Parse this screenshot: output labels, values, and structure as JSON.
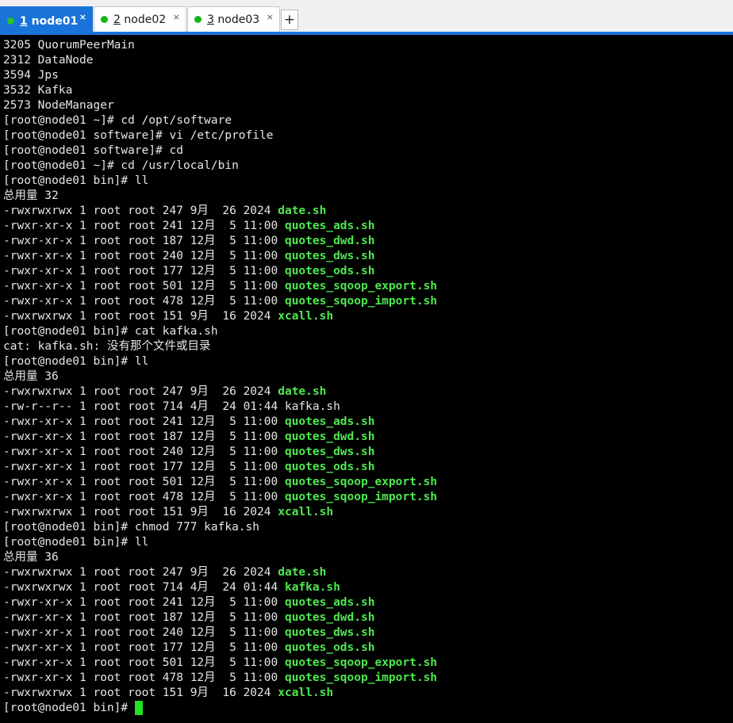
{
  "tabs": [
    {
      "num": "1",
      "name": "node01",
      "active": true
    },
    {
      "num": "2",
      "name": "node02",
      "active": false
    },
    {
      "num": "3",
      "name": "node03",
      "active": false
    }
  ],
  "new_tab_label": "+",
  "close_glyph": "×",
  "colors": {
    "tab_active": "#1a73d9",
    "status_dot": "#16b316",
    "terminal_bg": "#000000",
    "terminal_text": "#e6e6e6",
    "executable": "#4ee84e",
    "cursor": "#22e022"
  },
  "terminal_lines": [
    {
      "text": "3205 QuorumPeerMain",
      "file": ""
    },
    {
      "text": "2312 DataNode",
      "file": ""
    },
    {
      "text": "3594 Jps",
      "file": ""
    },
    {
      "text": "3532 Kafka",
      "file": ""
    },
    {
      "text": "2573 NodeManager",
      "file": ""
    },
    {
      "text": "[root@node01 ~]# cd /opt/software",
      "file": ""
    },
    {
      "text": "[root@node01 software]# vi /etc/profile",
      "file": ""
    },
    {
      "text": "[root@node01 software]# cd",
      "file": ""
    },
    {
      "text": "[root@node01 ~]# cd /usr/local/bin",
      "file": ""
    },
    {
      "text": "[root@node01 bin]# ll",
      "file": ""
    },
    {
      "text": "总用量 32",
      "file": ""
    },
    {
      "text": "-rwxrwxrwx 1 root root 247 9月  26 2024 ",
      "file": "date.sh"
    },
    {
      "text": "-rwxr-xr-x 1 root root 241 12月  5 11:00 ",
      "file": "quotes_ads.sh"
    },
    {
      "text": "-rwxr-xr-x 1 root root 187 12月  5 11:00 ",
      "file": "quotes_dwd.sh"
    },
    {
      "text": "-rwxr-xr-x 1 root root 240 12月  5 11:00 ",
      "file": "quotes_dws.sh"
    },
    {
      "text": "-rwxr-xr-x 1 root root 177 12月  5 11:00 ",
      "file": "quotes_ods.sh"
    },
    {
      "text": "-rwxr-xr-x 1 root root 501 12月  5 11:00 ",
      "file": "quotes_sqoop_export.sh"
    },
    {
      "text": "-rwxr-xr-x 1 root root 478 12月  5 11:00 ",
      "file": "quotes_sqoop_import.sh"
    },
    {
      "text": "-rwxrwxrwx 1 root root 151 9月  16 2024 ",
      "file": "xcall.sh"
    },
    {
      "text": "[root@node01 bin]# cat kafka.sh",
      "file": ""
    },
    {
      "text": "cat: kafka.sh: 没有那个文件或目录",
      "file": ""
    },
    {
      "text": "[root@node01 bin]# ll",
      "file": ""
    },
    {
      "text": "总用量 36",
      "file": ""
    },
    {
      "text": "-rwxrwxrwx 1 root root 247 9月  26 2024 ",
      "file": "date.sh"
    },
    {
      "text": "-rw-r--r-- 1 root root 714 4月  24 01:44 kafka.sh",
      "file": ""
    },
    {
      "text": "-rwxr-xr-x 1 root root 241 12月  5 11:00 ",
      "file": "quotes_ads.sh"
    },
    {
      "text": "-rwxr-xr-x 1 root root 187 12月  5 11:00 ",
      "file": "quotes_dwd.sh"
    },
    {
      "text": "-rwxr-xr-x 1 root root 240 12月  5 11:00 ",
      "file": "quotes_dws.sh"
    },
    {
      "text": "-rwxr-xr-x 1 root root 177 12月  5 11:00 ",
      "file": "quotes_ods.sh"
    },
    {
      "text": "-rwxr-xr-x 1 root root 501 12月  5 11:00 ",
      "file": "quotes_sqoop_export.sh"
    },
    {
      "text": "-rwxr-xr-x 1 root root 478 12月  5 11:00 ",
      "file": "quotes_sqoop_import.sh"
    },
    {
      "text": "-rwxrwxrwx 1 root root 151 9月  16 2024 ",
      "file": "xcall.sh"
    },
    {
      "text": "[root@node01 bin]# chmod 777 kafka.sh",
      "file": ""
    },
    {
      "text": "[root@node01 bin]# ll",
      "file": ""
    },
    {
      "text": "总用量 36",
      "file": ""
    },
    {
      "text": "-rwxrwxrwx 1 root root 247 9月  26 2024 ",
      "file": "date.sh"
    },
    {
      "text": "-rwxrwxrwx 1 root root 714 4月  24 01:44 ",
      "file": "kafka.sh"
    },
    {
      "text": "-rwxr-xr-x 1 root root 241 12月  5 11:00 ",
      "file": "quotes_ads.sh"
    },
    {
      "text": "-rwxr-xr-x 1 root root 187 12月  5 11:00 ",
      "file": "quotes_dwd.sh"
    },
    {
      "text": "-rwxr-xr-x 1 root root 240 12月  5 11:00 ",
      "file": "quotes_dws.sh"
    },
    {
      "text": "-rwxr-xr-x 1 root root 177 12月  5 11:00 ",
      "file": "quotes_ods.sh"
    },
    {
      "text": "-rwxr-xr-x 1 root root 501 12月  5 11:00 ",
      "file": "quotes_sqoop_export.sh"
    },
    {
      "text": "-rwxr-xr-x 1 root root 478 12月  5 11:00 ",
      "file": "quotes_sqoop_import.sh"
    },
    {
      "text": "-rwxrwxrwx 1 root root 151 9月  16 2024 ",
      "file": "xcall.sh"
    }
  ],
  "prompt": "[root@node01 bin]# "
}
